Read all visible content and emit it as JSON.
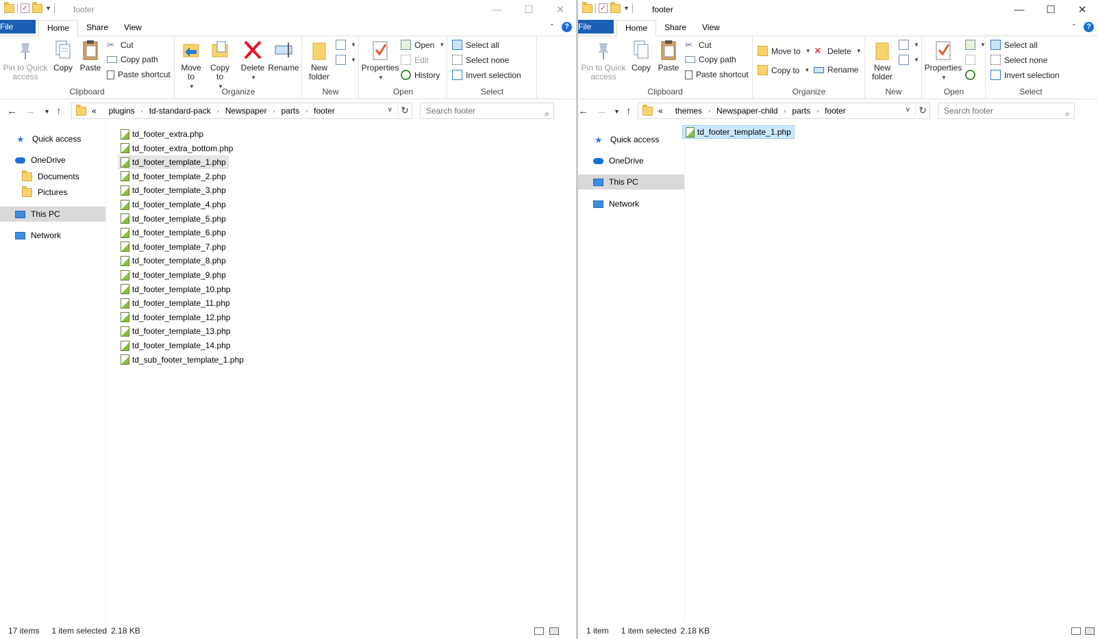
{
  "left": {
    "title": "footer",
    "tabs": [
      "File",
      "Home",
      "Share",
      "View"
    ],
    "clipboard": {
      "pin": "Pin to Quick access",
      "copy": "Copy",
      "paste": "Paste",
      "cut": "Cut",
      "copy_path": "Copy path",
      "paste_shortcut": "Paste shortcut",
      "label": "Clipboard"
    },
    "organize": {
      "move_to": "Move to",
      "copy_to": "Copy to",
      "delete": "Delete",
      "rename": "Rename",
      "label": "Organize"
    },
    "new": {
      "new_folder": "New folder",
      "label": "New"
    },
    "open": {
      "properties": "Properties",
      "open": "Open",
      "edit": "Edit",
      "history": "History",
      "label": "Open"
    },
    "select": {
      "select_all": "Select all",
      "select_none": "Select none",
      "invert": "Invert selection",
      "label": "Select"
    },
    "address": {
      "prefix": "«",
      "crumbs": [
        "plugins",
        "td-standard-pack",
        "Newspaper",
        "parts",
        "footer"
      ]
    },
    "search_placeholder": "Search footer",
    "nav": {
      "quick_access": "Quick access",
      "onedrive": "OneDrive",
      "documents": "Documents",
      "pictures": "Pictures",
      "this_pc": "This PC",
      "network": "Network"
    },
    "files": [
      "td_footer_extra.php",
      "td_footer_extra_bottom.php",
      "td_footer_template_1.php",
      "td_footer_template_2.php",
      "td_footer_template_3.php",
      "td_footer_template_4.php",
      "td_footer_template_5.php",
      "td_footer_template_6.php",
      "td_footer_template_7.php",
      "td_footer_template_8.php",
      "td_footer_template_9.php",
      "td_footer_template_10.php",
      "td_footer_template_11.php",
      "td_footer_template_12.php",
      "td_footer_template_13.php",
      "td_footer_template_14.php",
      "td_sub_footer_template_1.php"
    ],
    "status": {
      "count": "17 items",
      "selected": "1 item selected",
      "size": "2.18 KB"
    }
  },
  "right": {
    "title": "footer",
    "tabs": [
      "File",
      "Home",
      "Share",
      "View"
    ],
    "clipboard": {
      "pin": "Pin to Quick access",
      "copy": "Copy",
      "paste": "Paste",
      "cut": "Cut",
      "copy_path": "Copy path",
      "paste_shortcut": "Paste shortcut",
      "label": "Clipboard"
    },
    "organize": {
      "move_to": "Move to",
      "copy_to": "Copy to",
      "delete": "Delete",
      "rename": "Rename",
      "label": "Organize"
    },
    "new": {
      "new_folder": "New folder",
      "label": "New"
    },
    "open": {
      "properties": "Properties",
      "label": "Open"
    },
    "select": {
      "select_all": "Select all",
      "select_none": "Select none",
      "invert": "Invert selection",
      "label": "Select"
    },
    "address": {
      "prefix": "«",
      "crumbs": [
        "themes",
        "Newspaper-child",
        "parts",
        "footer"
      ]
    },
    "search_placeholder": "Search footer",
    "nav": {
      "quick_access": "Quick access",
      "onedrive": "OneDrive",
      "this_pc": "This PC",
      "network": "Network"
    },
    "files": [
      "td_footer_template_1.php"
    ],
    "status": {
      "count": "1 item",
      "selected": "1 item selected",
      "size": "2.18 KB"
    }
  },
  "colors": {
    "file_tab": "#1a5fb4",
    "selection": "#cce8ff",
    "hover": "#e5e5e5",
    "delete_red": "#e81123"
  }
}
